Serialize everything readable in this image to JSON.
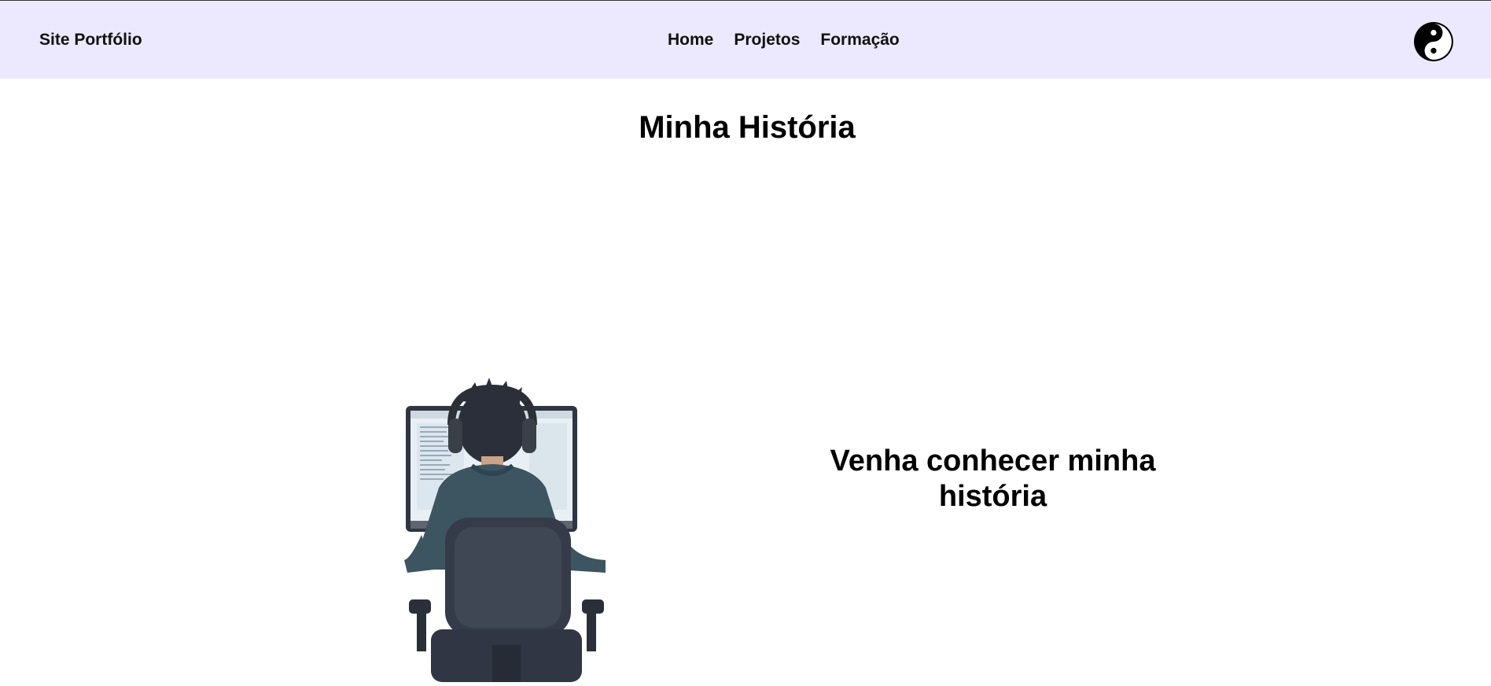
{
  "navbar": {
    "brand": "Site Portfólio",
    "links": [
      {
        "label": "Home"
      },
      {
        "label": "Projetos"
      },
      {
        "label": "Formação"
      }
    ],
    "theme_toggle_icon": "yin-yang-icon",
    "background_color": "#ece9fe"
  },
  "main": {
    "title": "Minha História",
    "tagline": "Venha conhecer minha história",
    "illustration_icon": "person-at-computer-illustration"
  }
}
